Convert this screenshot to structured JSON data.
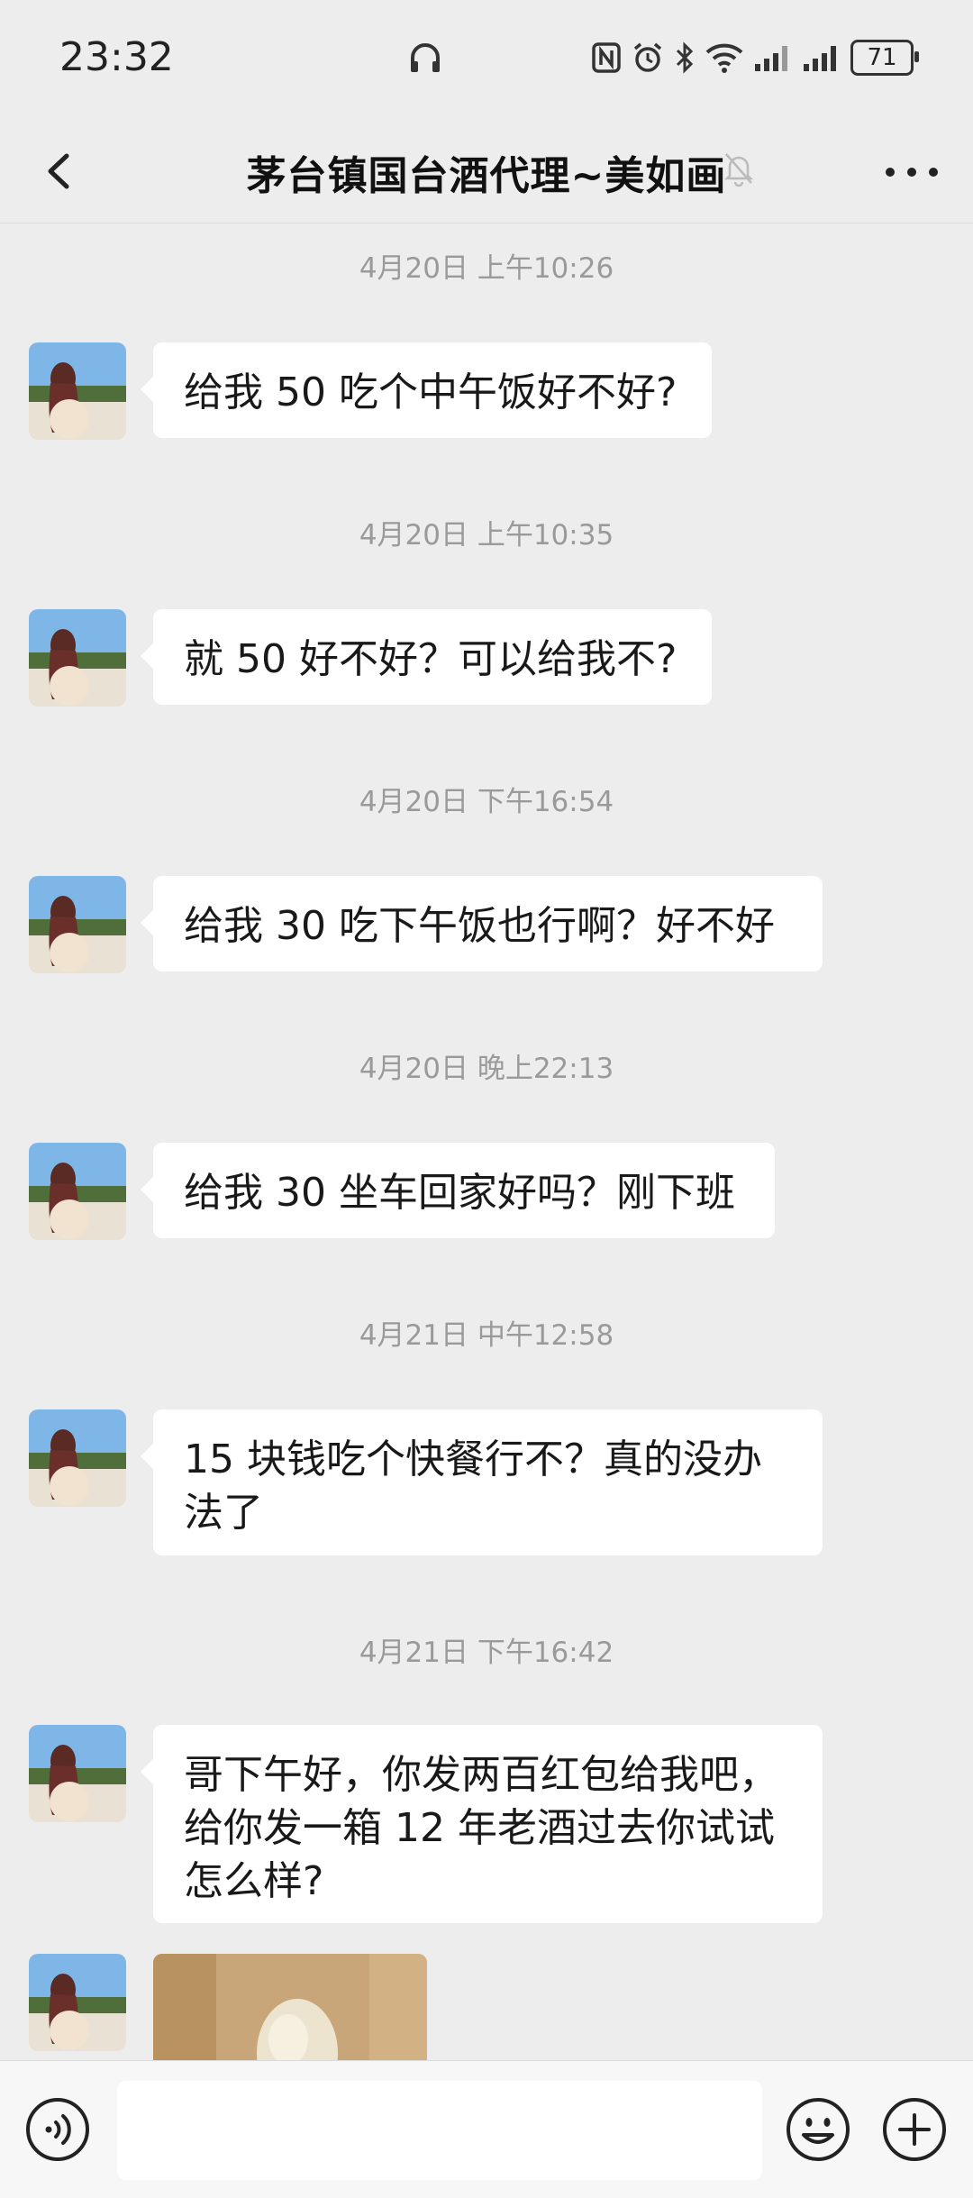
{
  "status_bar": {
    "time": "23:32",
    "battery": "71"
  },
  "nav": {
    "title": "茅台镇国台酒代理~美如画"
  },
  "messages": [
    {
      "timestamp": "4月20日 上午10:26",
      "text": "给我 50 吃个中午饭好不好?"
    },
    {
      "timestamp": "4月20日 上午10:35",
      "text": "就 50 好不好？可以给我不?"
    },
    {
      "timestamp": "4月20日 下午16:54",
      "text": "给我 30 吃下午饭也行啊？好不好"
    },
    {
      "timestamp": "4月20日 晚上22:13",
      "text": "给我 30 坐车回家好吗？刚下班"
    },
    {
      "timestamp": "4月21日 中午12:58",
      "text": "15 块钱吃个快餐行不？真的没办法了"
    },
    {
      "timestamp": "4月21日 下午16:42",
      "text": "哥下午好，你发两百红包给我吧，给你发一箱 12 年老酒过去你试试怎么样?"
    }
  ],
  "input": {
    "placeholder": ""
  },
  "icons": {
    "back": "chevron-left-icon",
    "mute": "bell-off-icon",
    "more": "more-dots-icon",
    "voice": "voice-icon",
    "emoji": "emoji-icon",
    "plus": "plus-icon"
  }
}
